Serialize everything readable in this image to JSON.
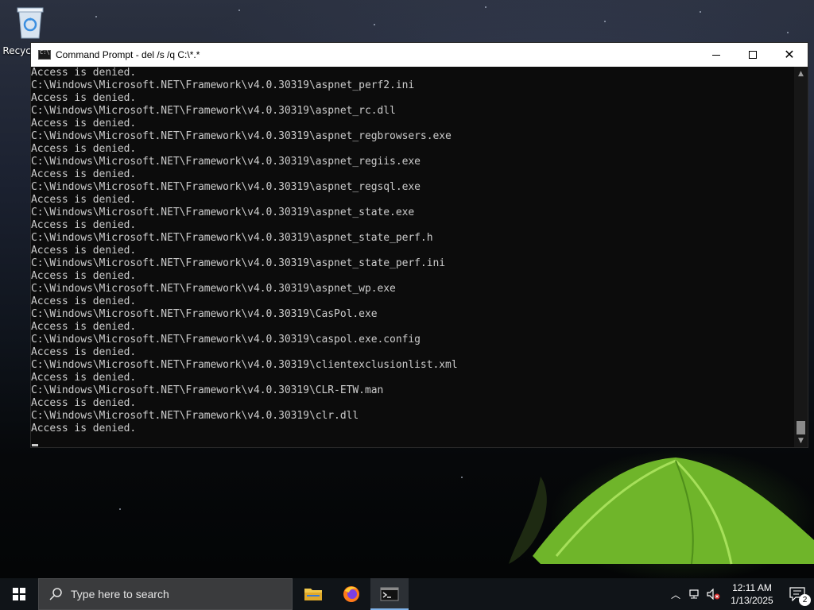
{
  "desktop": {
    "recycle_bin_label": "Recycle Bin"
  },
  "window": {
    "title": "Command Prompt - del  /s /q C:\\*.*",
    "controls": {
      "minimize": "minimize",
      "maximize": "maximize",
      "close": "close"
    }
  },
  "console": {
    "lines": [
      "Access is denied.",
      "C:\\Windows\\Microsoft.NET\\Framework\\v4.0.30319\\aspnet_perf2.ini",
      "Access is denied.",
      "C:\\Windows\\Microsoft.NET\\Framework\\v4.0.30319\\aspnet_rc.dll",
      "Access is denied.",
      "C:\\Windows\\Microsoft.NET\\Framework\\v4.0.30319\\aspnet_regbrowsers.exe",
      "Access is denied.",
      "C:\\Windows\\Microsoft.NET\\Framework\\v4.0.30319\\aspnet_regiis.exe",
      "Access is denied.",
      "C:\\Windows\\Microsoft.NET\\Framework\\v4.0.30319\\aspnet_regsql.exe",
      "Access is denied.",
      "C:\\Windows\\Microsoft.NET\\Framework\\v4.0.30319\\aspnet_state.exe",
      "Access is denied.",
      "C:\\Windows\\Microsoft.NET\\Framework\\v4.0.30319\\aspnet_state_perf.h",
      "Access is denied.",
      "C:\\Windows\\Microsoft.NET\\Framework\\v4.0.30319\\aspnet_state_perf.ini",
      "Access is denied.",
      "C:\\Windows\\Microsoft.NET\\Framework\\v4.0.30319\\aspnet_wp.exe",
      "Access is denied.",
      "C:\\Windows\\Microsoft.NET\\Framework\\v4.0.30319\\CasPol.exe",
      "Access is denied.",
      "C:\\Windows\\Microsoft.NET\\Framework\\v4.0.30319\\caspol.exe.config",
      "Access is denied.",
      "C:\\Windows\\Microsoft.NET\\Framework\\v4.0.30319\\clientexclusionlist.xml",
      "Access is denied.",
      "C:\\Windows\\Microsoft.NET\\Framework\\v4.0.30319\\CLR-ETW.man",
      "Access is denied.",
      "C:\\Windows\\Microsoft.NET\\Framework\\v4.0.30319\\clr.dll",
      "Access is denied."
    ],
    "text_color": "#cccccc",
    "background_color": "#0c0c0c"
  },
  "taskbar": {
    "search_placeholder": "Type here to search",
    "apps": [
      {
        "name": "File Explorer",
        "icon": "folder-icon",
        "active": false
      },
      {
        "name": "Firefox",
        "icon": "firefox-icon",
        "active": false
      },
      {
        "name": "Command Prompt",
        "icon": "cmd-icon",
        "active": true
      }
    ],
    "tray": {
      "time": "12:11 AM",
      "date": "1/13/2025",
      "notification_count": "2"
    },
    "accent_color": "#7fb2e8"
  }
}
